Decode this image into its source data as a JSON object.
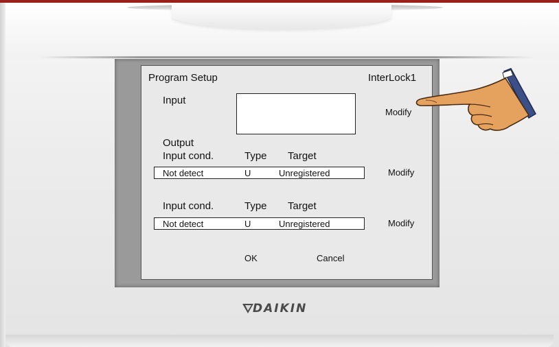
{
  "dialog": {
    "title": "Program Setup",
    "name": "InterLock1",
    "input_label": "Input",
    "input_modify": "Modify",
    "output_label": "Output",
    "rows": [
      {
        "headers": [
          "Input cond.",
          "Type",
          "Target"
        ],
        "values": [
          "Not detect",
          "U",
          "Unregistered"
        ],
        "modify": "Modify"
      },
      {
        "headers": [
          "Input cond.",
          "Type",
          "Target"
        ],
        "values": [
          "Not detect",
          "U",
          "Unregistered"
        ],
        "modify": "Modify"
      }
    ],
    "ok": "OK",
    "cancel": "Cancel"
  },
  "brand": {
    "logo_text": "DAIKIN"
  },
  "icons": [
    "pointing-hand-icon",
    "daikin-logo-mark-icon"
  ],
  "colors": {
    "frame_top": "#9a2020",
    "bezel": "#9a9a9a",
    "screen": "#e9e9e9"
  }
}
